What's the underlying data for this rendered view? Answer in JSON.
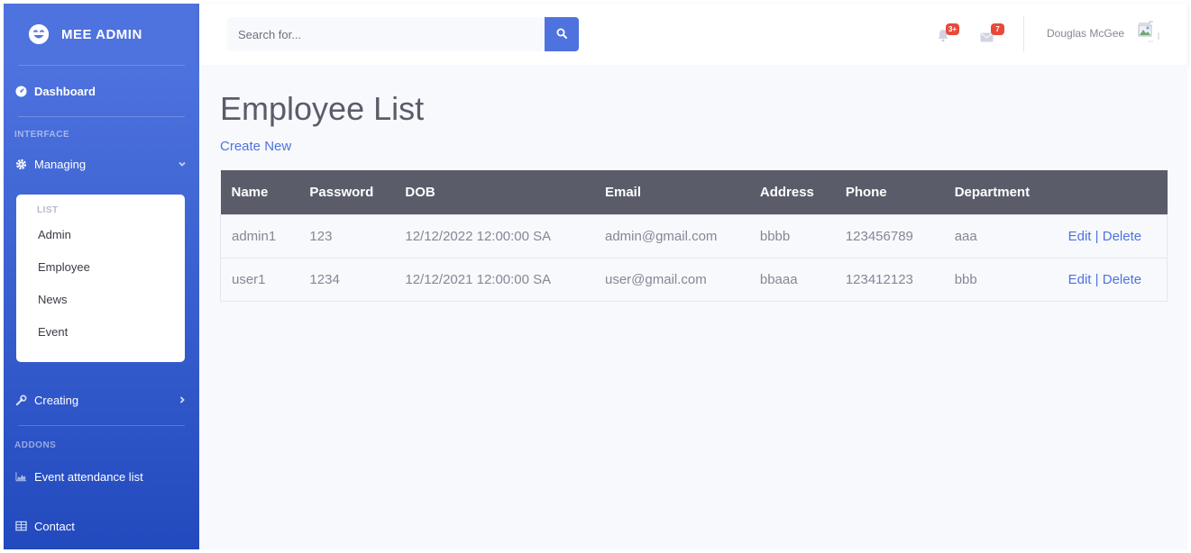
{
  "brand": {
    "name": "MEE ADMIN"
  },
  "sidebar": {
    "dashboard": "Dashboard",
    "interface_heading": "INTERFACE",
    "managing": "Managing",
    "collapse": {
      "heading": "LIST",
      "items": [
        "Admin",
        "Employee",
        "News",
        "Event"
      ]
    },
    "creating": "Creating",
    "addons_heading": "ADDONS",
    "event_attendance": "Event attendance list",
    "contact": "Contact"
  },
  "topbar": {
    "search_placeholder": "Search for...",
    "alerts_badge": "3+",
    "messages_badge": "7",
    "user_name": "Douglas McGee"
  },
  "main": {
    "title": "Employee List",
    "create_new": "Create New",
    "table": {
      "columns": [
        "Name",
        "Password",
        "DOB",
        "Email",
        "Address",
        "Phone",
        "Department",
        ""
      ],
      "rows": [
        {
          "name": "admin1",
          "password": "123",
          "dob": "12/12/2022 12:00:00 SA",
          "email": "admin@gmail.com",
          "address": "bbbb",
          "phone": "123456789",
          "department": "aaa",
          "edit": "Edit",
          "delete": "Delete"
        },
        {
          "name": "user1",
          "password": "1234",
          "dob": "12/12/2021 12:00:00 SA",
          "email": "user@gmail.com",
          "address": "bbaaa",
          "phone": "123412123",
          "department": "bbb",
          "edit": "Edit",
          "delete": "Delete"
        }
      ]
    }
  },
  "colors": {
    "primary": "#4e73df",
    "sidebar_dark": "#224abe",
    "header_bg": "#5a5c69",
    "danger": "#e74a3b",
    "text_muted": "#858796"
  }
}
